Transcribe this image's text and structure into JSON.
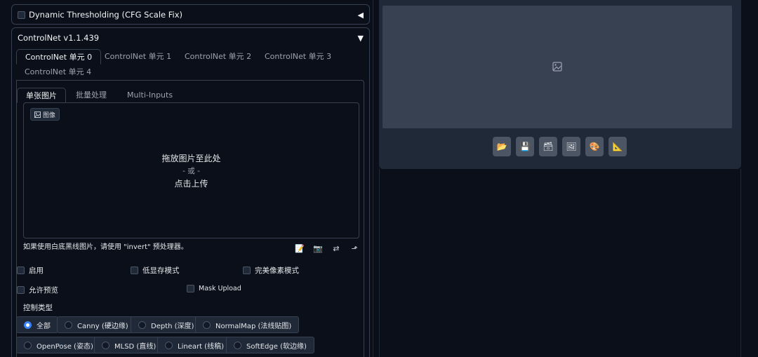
{
  "dynamic_thresholding": {
    "title": "Dynamic Thresholding (CFG Scale Fix)",
    "toggle": "◀"
  },
  "controlnet": {
    "title": "ControlNet v1.1.439",
    "toggle": "▼",
    "unit_tabs": [
      "ControlNet 单元 0",
      "ControlNet 单元 1",
      "ControlNet 单元 2",
      "ControlNet 单元 3",
      "ControlNet 单元 4"
    ],
    "sub_tabs": [
      "单张图片",
      "批量处理",
      "Multi-Inputs"
    ],
    "image_badge": "图像",
    "drop_line1": "拖放图片至此处",
    "drop_or": "- 或 -",
    "drop_line2": "点击上传",
    "hint": "如果使用白底黑线图片，请使用 \"invert\" 预处理器。",
    "options": {
      "enable": "启用",
      "low_vram": "低显存模式",
      "pixel_perfect": "完美像素模式",
      "allow_preview": "允许预览",
      "mask_upload": "Mask Upload"
    },
    "control_type_label": "控制类型",
    "control_types": [
      "全部",
      "Canny (硬边缘)",
      "Depth (深度)",
      "NormalMap (法线贴图)",
      "OpenPose (姿态)",
      "MLSD (直线)",
      "Lineart (线稿)",
      "SoftEdge (软边缘)"
    ],
    "control_type_selected": "全部"
  }
}
